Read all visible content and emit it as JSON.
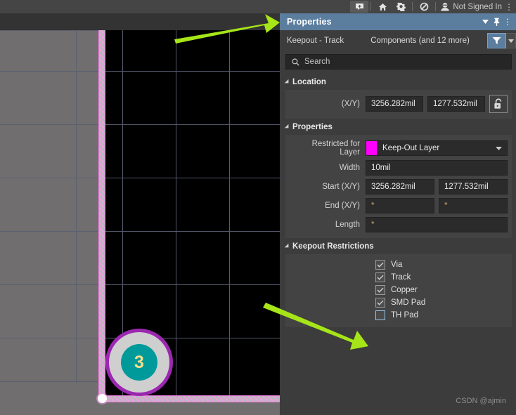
{
  "toolbar": {
    "icons": [
      {
        "name": "comment-add-icon",
        "glyph": "💬",
        "active": true
      },
      {
        "name": "home-icon",
        "glyph": "⌂"
      },
      {
        "name": "gear-icon",
        "glyph": "⚙"
      },
      {
        "name": "extensions-icon",
        "glyph": "⊘"
      },
      {
        "name": "user-icon",
        "glyph": "☺"
      }
    ],
    "account_label": "Not Signed In",
    "overflow_label": "⋮"
  },
  "panel": {
    "title": "Properties",
    "header_icons": [
      {
        "name": "chevron-down-icon",
        "glyph": "▼"
      },
      {
        "name": "pin-icon",
        "glyph": "📌"
      },
      {
        "name": "panel-menu-icon",
        "glyph": "⋮"
      }
    ],
    "object_name": "Keepout - Track",
    "scope_label": "Components (and 12 more)",
    "filter_icon_name": "filter-funnel-icon",
    "filter_dropdown_glyph": "▼",
    "search": {
      "icon_name": "search-icon",
      "placeholder": "Search",
      "value": ""
    },
    "sections": {
      "location": {
        "title": "Location",
        "xy_label": "(X/Y)",
        "x_value": "3256.282mil",
        "y_value": "1277.532mil",
        "lock_icon_name": "unlock-icon",
        "locked": false
      },
      "properties": {
        "title": "Properties",
        "restricted_label": "Restricted for Layer",
        "restricted_value": "Keep-Out Layer",
        "restricted_swatch_color": "#ff00ff",
        "width_label": "Width",
        "width_value": "10mil",
        "start_label": "Start (X/Y)",
        "start_x": "3256.282mil",
        "start_y": "1277.532mil",
        "end_label": "End (X/Y)",
        "end_x": "*",
        "end_y": "*",
        "length_label": "Length",
        "length_value": "*"
      },
      "keepout": {
        "title": "Keepout Restrictions",
        "items": [
          {
            "label": "Via",
            "checked": true
          },
          {
            "label": "Track",
            "checked": true
          },
          {
            "label": "Copper",
            "checked": true
          },
          {
            "label": "SMD Pad",
            "checked": true
          },
          {
            "label": "TH Pad",
            "checked": false
          }
        ]
      }
    }
  },
  "canvas": {
    "pad": {
      "designator": "3",
      "ring_color": "#9c27b0",
      "body_color": "#cfcfcf",
      "hole_color": "#009a9a",
      "text_color": "#f7e08a"
    },
    "keepout_outline_color": "#ee7bdf",
    "board_color": "#000000",
    "surround_color": "#706e6e"
  },
  "annotations": {
    "arrow_color": "#a6e518",
    "arrows": [
      {
        "name": "arrow-to-properties-panel"
      },
      {
        "name": "arrow-to-th-pad-checkbox"
      }
    ]
  },
  "watermark": "CSDN @ajmin"
}
